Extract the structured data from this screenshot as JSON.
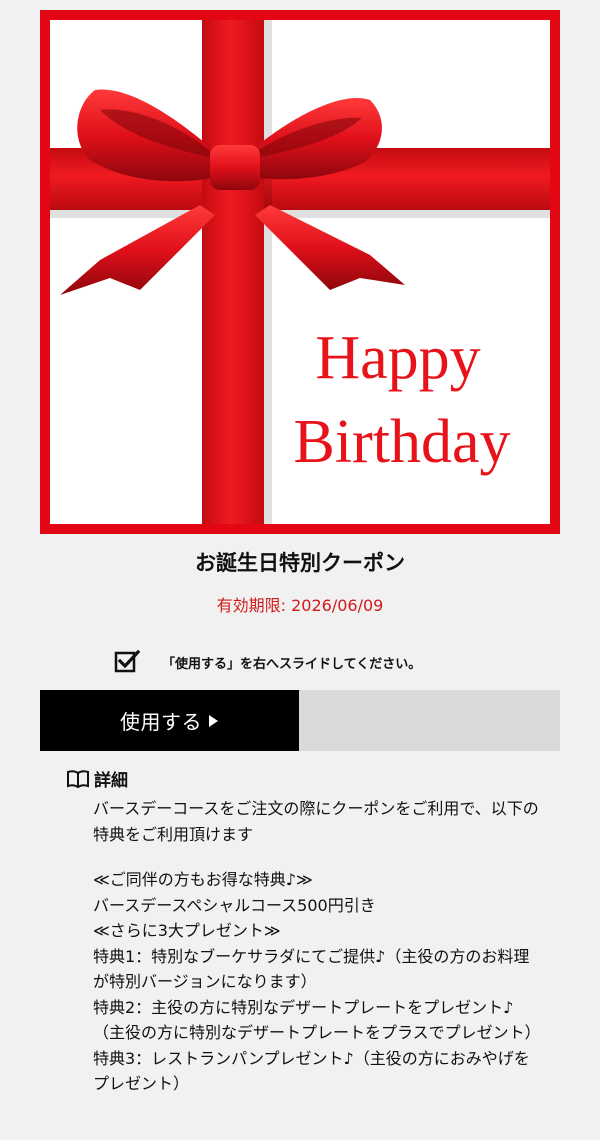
{
  "image": {
    "title_line1": "Happy",
    "title_line2": "Birthday",
    "colors": {
      "ribbon": "#e8121a",
      "border": "#e30613",
      "background": "#ffffff"
    }
  },
  "coupon": {
    "title": "お誕生日特別クーポン",
    "expiry": "有効期限: 2026/06/09"
  },
  "instruction": {
    "icon": "checkbox-checked-icon",
    "text": "「使用する」を右へスライドしてください。"
  },
  "slider": {
    "label": "使用する",
    "icon": "play-icon",
    "progress": 0
  },
  "details": {
    "icon": "book-icon",
    "title": "詳細",
    "intro": "バースデーコースをご注文の際にクーポンをご利用で、以下の特典をご利用頂けます",
    "lines": [
      "≪ご同伴の方もお得な特典♪≫",
      "バースデースペシャルコース500円引き",
      "≪さらに3大プレゼント≫",
      "特典1：特別なブーケサラダにてご提供♪（主役の方のお料理が特別バージョンになります）",
      "特典2：主役の方に特別なデザートプレートをプレゼント♪（主役の方に特別なデザートプレートをプラスでプレゼント）",
      "特典3：レストランパンプレゼント♪（主役の方におみやげをプレゼント）"
    ]
  }
}
